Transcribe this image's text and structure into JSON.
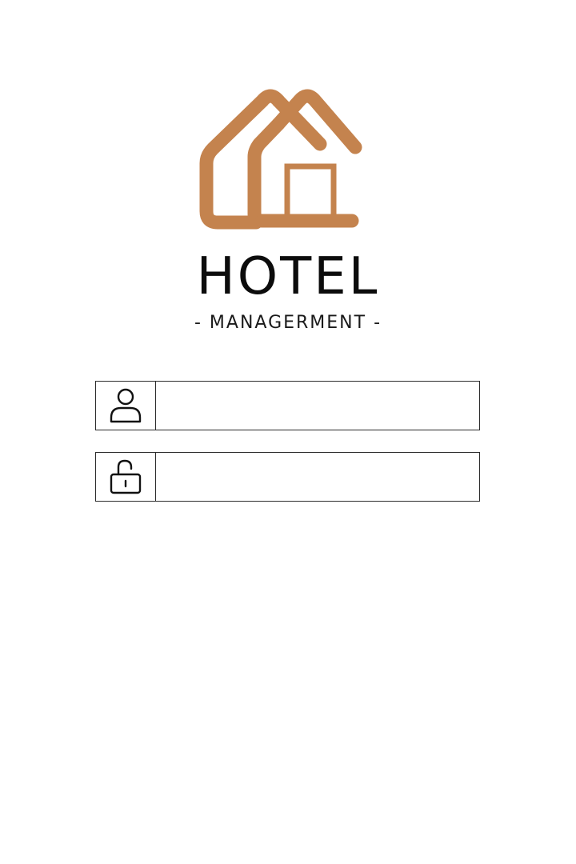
{
  "brand": {
    "title": "HOTEL",
    "subtitle": "- MANAGERMENT -",
    "accent_color": "#C4834E",
    "logo_icon": "house-logo-icon"
  },
  "login_form": {
    "username": {
      "icon": "user-icon",
      "value": "",
      "placeholder": ""
    },
    "password": {
      "icon": "unlock-icon",
      "value": "",
      "placeholder": ""
    }
  }
}
